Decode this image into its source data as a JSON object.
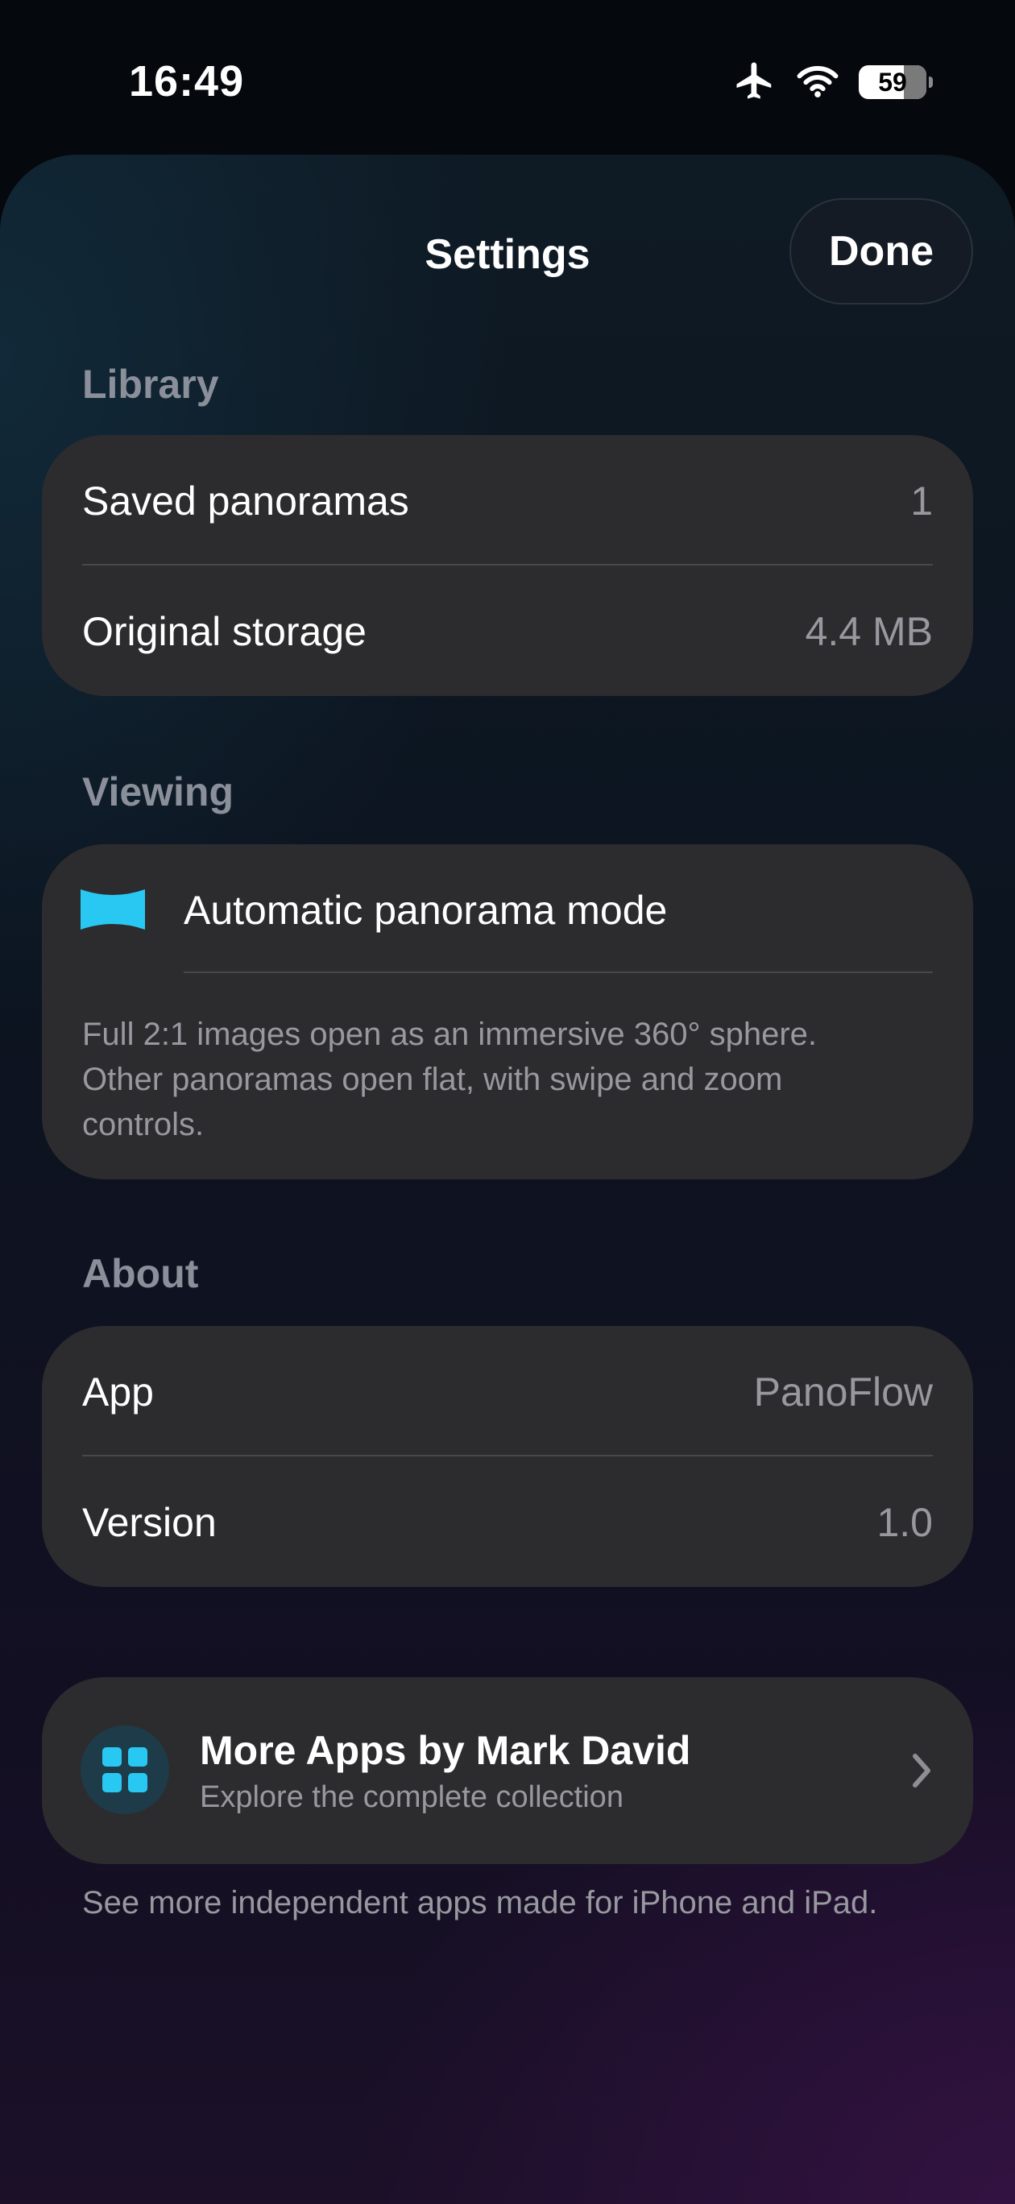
{
  "status_bar": {
    "time": "16:49",
    "battery": "59"
  },
  "header": {
    "title": "Settings",
    "done_label": "Done"
  },
  "library": {
    "header": "Library",
    "rows": [
      {
        "label": "Saved panoramas",
        "value": "1"
      },
      {
        "label": "Original storage",
        "value": "4.4 MB"
      }
    ]
  },
  "viewing": {
    "header": "Viewing",
    "mode_label": "Automatic panorama mode",
    "note_lines": [
      "Full 2:1 images open as an immersive 360° sphere.",
      "Other panoramas open flat, with swipe and zoom",
      "controls."
    ]
  },
  "about": {
    "header": "About",
    "rows": [
      {
        "label": "App",
        "value": "PanoFlow"
      },
      {
        "label": "Version",
        "value": "1.0"
      }
    ]
  },
  "more_apps": {
    "title": "More Apps by Mark David",
    "subtitle": "Explore the complete collection",
    "footer": "See more independent apps made for iPhone and iPad."
  },
  "colors": {
    "accent": "#29c8f2",
    "card": "#2c2c2e",
    "secondary_text": "#98989f"
  },
  "icons": [
    "airplane-icon",
    "wifi-icon",
    "battery-icon",
    "panorama-icon",
    "app-grid-icon",
    "chevron-right-icon"
  ]
}
